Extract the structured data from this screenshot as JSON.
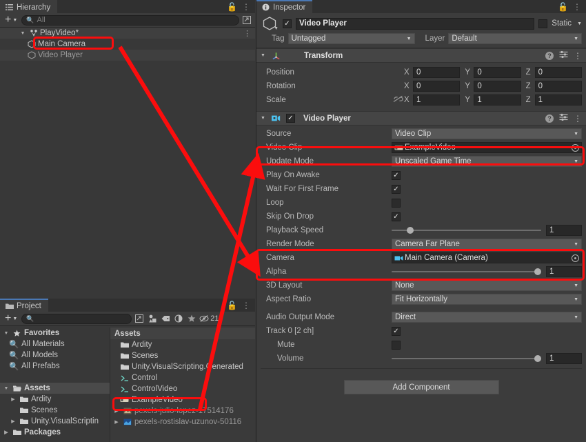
{
  "hierarchy": {
    "tab_label": "Hierarchy",
    "tab_icon": "hierarchy-icon",
    "toolbar": {
      "add_label": "+",
      "search_placeholder": "All",
      "search_value": ""
    },
    "rows": [
      {
        "label": "PlayVideo*",
        "icon": "scene-icon",
        "depth": 0,
        "expanded": true,
        "selected": false
      },
      {
        "label": "Main Camera",
        "icon": "gameobject-icon",
        "depth": 1,
        "expanded": false,
        "selected": false
      },
      {
        "label": "Video Player",
        "icon": "gameobject-icon",
        "depth": 1,
        "expanded": false,
        "selected": true
      }
    ]
  },
  "project": {
    "tab_label": "Project",
    "toolbar": {
      "add_label": "+",
      "search_value": "",
      "visible_count": "21"
    },
    "tree": [
      {
        "label": "Favorites",
        "depth": 0,
        "icon": "star-icon",
        "bold": true,
        "tri": "down"
      },
      {
        "label": "All Materials",
        "depth": 1,
        "icon": "search-icon",
        "bold": false,
        "tri": "none"
      },
      {
        "label": "All Models",
        "depth": 1,
        "icon": "search-icon",
        "bold": false,
        "tri": "none"
      },
      {
        "label": "All Prefabs",
        "depth": 1,
        "icon": "search-icon",
        "bold": false,
        "tri": "none"
      },
      {
        "label": "",
        "depth": 0,
        "icon": "none",
        "bold": false,
        "tri": "none"
      },
      {
        "label": "Assets",
        "depth": 0,
        "icon": "folder-open-icon",
        "bold": true,
        "tri": "down",
        "selected": true
      },
      {
        "label": "Ardity",
        "depth": 1,
        "icon": "folder-icon",
        "bold": false,
        "tri": "right"
      },
      {
        "label": "Scenes",
        "depth": 1,
        "icon": "folder-icon",
        "bold": false,
        "tri": "none"
      },
      {
        "label": "Unity.VisualScriptin",
        "depth": 1,
        "icon": "folder-icon",
        "bold": false,
        "tri": "right"
      },
      {
        "label": "Packages",
        "depth": 0,
        "icon": "folder-icon",
        "bold": true,
        "tri": "right"
      }
    ],
    "content_header": "Assets",
    "items": [
      {
        "label": "Ardity",
        "icon": "folder-icon",
        "tri": "none"
      },
      {
        "label": "Scenes",
        "icon": "folder-icon",
        "tri": "none"
      },
      {
        "label": "Unity.VisualScripting.Generated",
        "icon": "folder-icon",
        "tri": "none"
      },
      {
        "label": "Control",
        "icon": "script-icon",
        "tri": "none"
      },
      {
        "label": "ControlVideo",
        "icon": "script-icon",
        "tri": "none"
      },
      {
        "label": "ExampleVideo",
        "icon": "videoclip-icon",
        "tri": "none"
      },
      {
        "label": "pexels-julio-lopez-17514176",
        "icon": "texture-icon",
        "tri": "right"
      },
      {
        "label": "pexels-rostislav-uzunov-50116",
        "icon": "texture-icon",
        "tri": "right"
      }
    ]
  },
  "inspector": {
    "tab_label": "Inspector",
    "tab_icon": "info-icon",
    "gameobject": {
      "enabled": true,
      "name": "Video Player",
      "static_checked": false,
      "static_label": "Static",
      "tag_label": "Tag",
      "tag_value": "Untagged",
      "layer_label": "Layer",
      "layer_value": "Default"
    },
    "transform": {
      "title": "Transform",
      "icon": "transform-icon",
      "rows": [
        {
          "label": "Position",
          "x": "0",
          "y": "0",
          "z": "0",
          "link": false
        },
        {
          "label": "Rotation",
          "x": "0",
          "y": "0",
          "z": "0",
          "link": false
        },
        {
          "label": "Scale",
          "x": "1",
          "y": "1",
          "z": "1",
          "link": true
        }
      ],
      "axes": [
        "X",
        "Y",
        "Z"
      ]
    },
    "video_player": {
      "title": "Video Player",
      "icon": "videoplayer-icon",
      "enabled": true,
      "fields": {
        "source_label": "Source",
        "source_value": "Video Clip",
        "video_clip_label": "Video Clip",
        "video_clip_value": "ExampleVideo",
        "update_mode_label": "Update Mode",
        "update_mode_value": "Unscaled Game Time",
        "play_on_awake_label": "Play On Awake",
        "play_on_awake_checked": true,
        "wait_first_frame_label": "Wait For First Frame",
        "wait_first_frame_checked": true,
        "loop_label": "Loop",
        "loop_checked": false,
        "skip_on_drop_label": "Skip On Drop",
        "skip_on_drop_checked": true,
        "playback_speed_label": "Playback Speed",
        "playback_speed_value": "1",
        "playback_speed_pct": 10,
        "render_mode_label": "Render Mode",
        "render_mode_value": "Camera Far Plane",
        "camera_label": "Camera",
        "camera_value": "Main Camera (Camera)",
        "alpha_label": "Alpha",
        "alpha_value": "1",
        "alpha_pct": 100,
        "layout3d_label": "3D Layout",
        "layout3d_value": "None",
        "aspect_ratio_label": "Aspect Ratio",
        "aspect_ratio_value": "Fit Horizontally",
        "audio_output_label": "Audio Output Mode",
        "audio_output_value": "Direct",
        "track0_label": "Track 0 [2 ch]",
        "track0_checked": true,
        "mute_label": "Mute",
        "mute_checked": false,
        "volume_label": "Volume",
        "volume_value": "1",
        "volume_pct": 100
      }
    },
    "add_component_label": "Add Component"
  },
  "annotations": {
    "color": "#fb0d0d",
    "highlight_boxes": [
      "main-camera-hierarchy",
      "video-clip-field",
      "render-mode-camera-group",
      "example-video-asset"
    ]
  }
}
